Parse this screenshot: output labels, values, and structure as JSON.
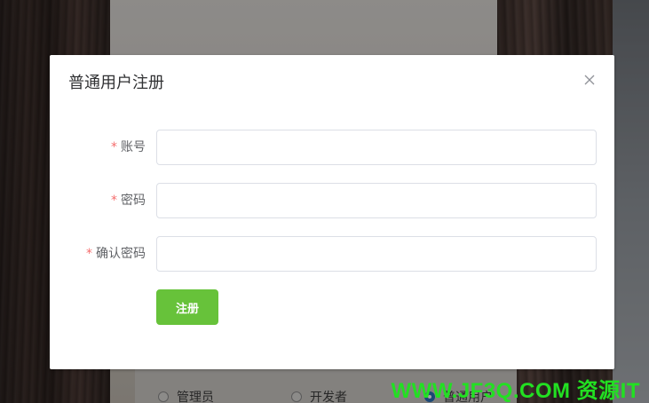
{
  "dialog": {
    "title": "普通用户注册",
    "close_icon": "close-icon"
  },
  "form": {
    "fields": [
      {
        "label": "账号",
        "required": true,
        "value": "",
        "placeholder": ""
      },
      {
        "label": "密码",
        "required": true,
        "value": "",
        "placeholder": ""
      },
      {
        "label": "确认密码",
        "required": true,
        "value": "",
        "placeholder": ""
      }
    ],
    "required_mark": "*",
    "submit_label": "注册"
  },
  "background_page": {
    "role_options": [
      {
        "label": "管理员",
        "selected": false
      },
      {
        "label": "开发者",
        "selected": false
      },
      {
        "label": "普通用户",
        "selected": true
      }
    ]
  },
  "watermark": "WWW.JF3Q.COM 资源IT",
  "colors": {
    "primary_button": "#67c23a",
    "required_mark": "#f56c6c",
    "radio_checked": "#2b6fb6",
    "watermark": "#22e022"
  }
}
